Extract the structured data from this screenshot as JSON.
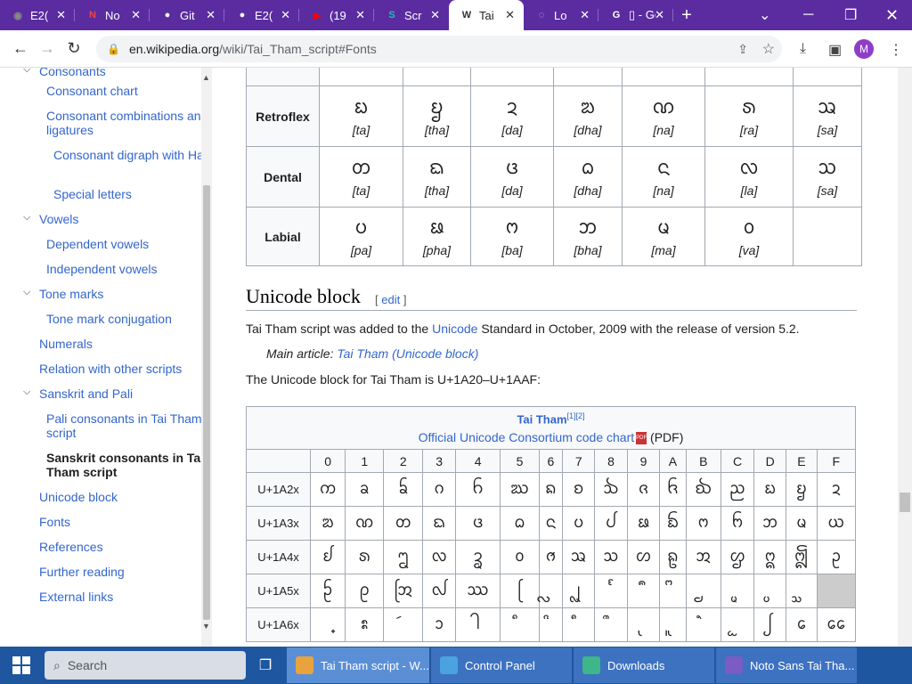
{
  "browser": {
    "tabs": [
      {
        "label": "E2(",
        "icon": "globe-icon"
      },
      {
        "label": "No",
        "icon": "notion-icon"
      },
      {
        "label": "Git",
        "icon": "github-icon"
      },
      {
        "label": "E2(",
        "icon": "github-icon"
      },
      {
        "label": "(19",
        "icon": "youtube-icon"
      },
      {
        "label": "Scr",
        "icon": "s-icon"
      },
      {
        "label": "Tai",
        "icon": "wikipedia-icon",
        "active": true
      },
      {
        "label": "Lo",
        "icon": "loading-icon"
      },
      {
        "label": "▯ - Goo",
        "icon": "google-icon"
      }
    ],
    "url_host": "en.wikipedia.org",
    "url_path": "/wiki/Tai_Tham_script#Fonts",
    "profile_initial": "M"
  },
  "sidebar": {
    "items": [
      {
        "label": "Consonants",
        "level": 1,
        "toggle": true
      },
      {
        "label": "Consonant chart",
        "level": 2
      },
      {
        "label": "Consonant combinations and ligatures",
        "level": 2
      },
      {
        "label": "Consonant digraph with Ha",
        "level": 3
      },
      {
        "label": "Special letters",
        "level": 3
      },
      {
        "label": "Vowels",
        "level": 1,
        "toggle": true
      },
      {
        "label": "Dependent vowels",
        "level": 2
      },
      {
        "label": "Independent vowels",
        "level": 2
      },
      {
        "label": "Tone marks",
        "level": 1,
        "toggle": true
      },
      {
        "label": "Tone mark conjugation",
        "level": 2
      },
      {
        "label": "Numerals",
        "level": 1
      },
      {
        "label": "Relation with other scripts",
        "level": 1
      },
      {
        "label": "Sanskrit and Pali",
        "level": 1,
        "toggle": true
      },
      {
        "label": "Pali consonants in Tai Tham script",
        "level": 2
      },
      {
        "label": "Sanskrit consonants in Tai Tham script",
        "level": 2,
        "bold": true
      },
      {
        "label": "Unicode block",
        "level": 1
      },
      {
        "label": "Fonts",
        "level": 1
      },
      {
        "label": "References",
        "level": 1
      },
      {
        "label": "Further reading",
        "level": 1
      },
      {
        "label": "External links",
        "level": 1
      }
    ]
  },
  "consonant_table": {
    "rows": [
      {
        "header": "Retroflex",
        "cells": [
          [
            "ᨭ",
            "[ta]"
          ],
          [
            "ᨮ",
            "[tha]"
          ],
          [
            "ᨯ",
            "[da]"
          ],
          [
            "ᨰ",
            "[dha]"
          ],
          [
            "ᨱ",
            "[na]"
          ],
          [
            "ᩁ",
            "[ra]"
          ],
          [
            "ᩇ",
            "[sa]"
          ]
        ]
      },
      {
        "header": "Dental",
        "cells": [
          [
            "ᨲ",
            "[ta]"
          ],
          [
            "ᨳ",
            "[tha]"
          ],
          [
            "ᨴ",
            "[da]"
          ],
          [
            "ᨵ",
            "[dha]"
          ],
          [
            "ᨶ",
            "[na]"
          ],
          [
            "ᩃ",
            "[la]"
          ],
          [
            "ᩈ",
            "[sa]"
          ]
        ]
      },
      {
        "header": "Labial",
        "cells": [
          [
            "ᨷ",
            "[pa]"
          ],
          [
            "ᨹ",
            "[pha]"
          ],
          [
            "ᨻ",
            "[ba]"
          ],
          [
            "ᨽ",
            "[bha]"
          ],
          [
            "ᨾ",
            "[ma]"
          ],
          [
            "ᩅ",
            "[va]"
          ],
          [
            "",
            ""
          ]
        ]
      }
    ]
  },
  "section": {
    "heading": "Unicode block",
    "edit_open": "[",
    "edit": "edit",
    "edit_close": "]",
    "para1_pre": "Tai Tham script was added to the ",
    "para1_link": "Unicode",
    "para1_post": " Standard in October, 2009 with the release of version 5.2.",
    "hatnote_label": "Main article: ",
    "hatnote_link": "Tai Tham (Unicode block)",
    "para2": "The Unicode block for Tai Tham is U+1A20–U+1AAF:"
  },
  "unicode_table": {
    "title": "Tai Tham",
    "refs": "[1][2]",
    "chart_link": "Official Unicode Consortium code chart",
    "chart_suffix": " (PDF)",
    "columns": [
      "0",
      "1",
      "2",
      "3",
      "4",
      "5",
      "6",
      "7",
      "8",
      "9",
      "A",
      "B",
      "C",
      "D",
      "E",
      "F"
    ],
    "rows": [
      {
        "label": "U+1A2x",
        "cells": [
          "ᨠ",
          "ᨡ",
          "ᨢ",
          "ᨣ",
          "ᨤ",
          "ᨥ",
          "ᨦ",
          "ᨧ",
          "ᨨ",
          "ᨩ",
          "ᨪ",
          "ᨫ",
          "ᨬ",
          "ᨭ",
          "ᨮ",
          "ᨯ"
        ]
      },
      {
        "label": "U+1A3x",
        "cells": [
          "ᨰ",
          "ᨱ",
          "ᨲ",
          "ᨳ",
          "ᨴ",
          "ᨵ",
          "ᨶ",
          "ᨷ",
          "ᨸ",
          "ᨹ",
          "ᨺ",
          "ᨻ",
          "ᨼ",
          "ᨽ",
          "ᨾ",
          "ᨿ"
        ]
      },
      {
        "label": "U+1A4x",
        "cells": [
          "ᩀ",
          "ᩁ",
          "ᩂ",
          "ᩃ",
          "ᩄ",
          "ᩅ",
          "ᩆ",
          "ᩇ",
          "ᩈ",
          "ᩉ",
          "ᩊ",
          "ᩋ",
          "ᩌ",
          "ᩍ",
          "ᩎ",
          "ᩏ"
        ]
      },
      {
        "label": "U+1A5x",
        "cells": [
          "ᩐ",
          "ᩑ",
          "ᩒ",
          "ᩓ",
          "ᩔ",
          "ᩕ",
          "ᩖ",
          "ᩗ",
          "ᩘ",
          "ᩙ",
          "ᩚ",
          "ᩛ",
          "ᩜ",
          "ᩝ",
          "ᩞ",
          ""
        ]
      },
      {
        "label": "U+1A6x",
        "cells": [
          "᩠",
          "ᩡ",
          "ᩢ",
          "ᩣ",
          "ᩤ",
          "ᩥ",
          "ᩦ",
          "ᩧ",
          "ᩨ",
          "ᩩ",
          "ᩪ",
          "ᩫ",
          "ᩬ",
          "ᩭ",
          "ᩮ",
          "ᩯ"
        ]
      }
    ]
  },
  "taskbar": {
    "search_placeholder": "Search",
    "apps": [
      {
        "label": "Tai Tham script - W...",
        "icon": "chrome-icon",
        "active": true
      },
      {
        "label": "Control Panel",
        "icon": "control-panel-icon"
      },
      {
        "label": "Downloads",
        "icon": "downloads-icon"
      },
      {
        "label": "Noto Sans Tai Tha...",
        "icon": "font-icon"
      }
    ]
  }
}
